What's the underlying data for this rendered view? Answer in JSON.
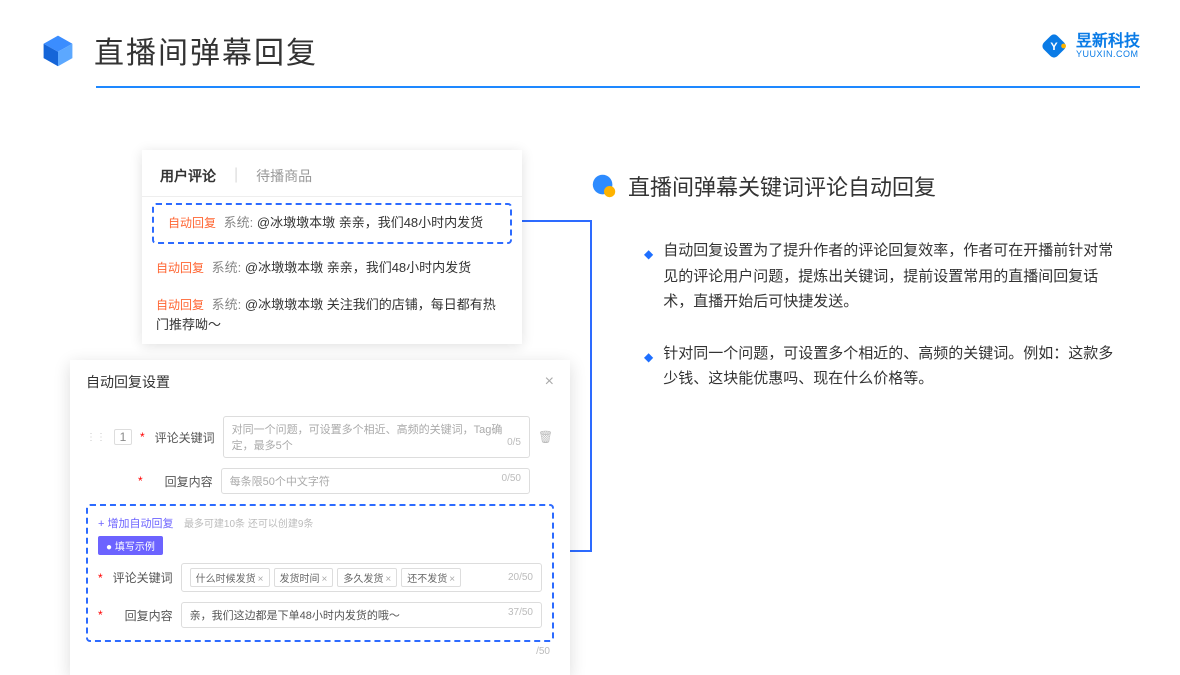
{
  "header": {
    "title": "直播间弹幕回复",
    "brand_cn": "昱新科技",
    "brand_en": "YUUXIN.COM"
  },
  "comments_card": {
    "tabs": {
      "active": "用户评论",
      "inactive": "待播商品"
    },
    "rows": [
      {
        "tag": "自动回复",
        "sys": "系统:",
        "text": "@冰墩墩本墩 亲亲，我们48小时内发货"
      },
      {
        "tag": "自动回复",
        "sys": "系统:",
        "text": "@冰墩墩本墩 亲亲，我们48小时内发货"
      },
      {
        "tag": "自动回复",
        "sys": "系统:",
        "text": "@冰墩墩本墩 关注我们的店铺，每日都有热门推荐呦～"
      }
    ]
  },
  "setting_card": {
    "title": "自动回复设置",
    "index": "1",
    "field1_label": "评论关键词",
    "field1_placeholder": "对同一个问题，可设置多个相近、高频的关键词，Tag确定，最多5个",
    "field1_counter": "0/5",
    "field2_label": "回复内容",
    "field2_placeholder": "每条限50个中文字符",
    "field2_counter": "0/50",
    "add_link": "+ 增加自动回复",
    "add_hint": "最多可建10条 还可以创建9条",
    "example_pill": "● 填写示例",
    "ex_field1_label": "评论关键词",
    "ex_chips": [
      "什么时候发货",
      "发货时间",
      "多久发货",
      "还不发货"
    ],
    "ex_field1_counter": "20/50",
    "ex_field2_label": "回复内容",
    "ex_field2_value": "亲，我们这边都是下单48小时内发货的哦～",
    "ex_field2_counter": "37/50",
    "trailing_counter": "/50"
  },
  "right": {
    "section_title": "直播间弹幕关键词评论自动回复",
    "bullets": [
      "自动回复设置为了提升作者的评论回复效率，作者可在开播前针对常见的评论用户问题，提炼出关键词，提前设置常用的直播间回复话术，直播开始后可快捷发送。",
      "针对同一个问题，可设置多个相近的、高频的关键词。例如：这款多少钱、这块能优惠吗、现在什么价格等。"
    ]
  }
}
